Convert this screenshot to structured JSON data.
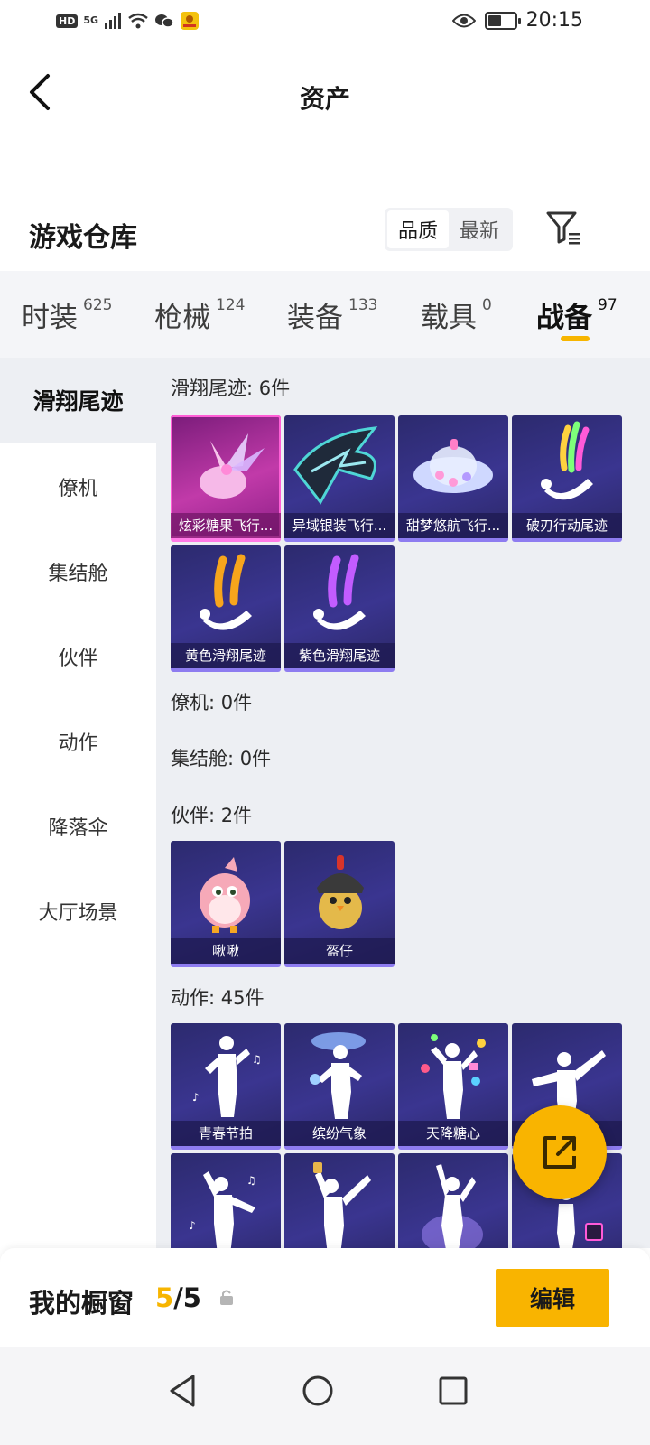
{
  "status_bar": {
    "hd_badge": "HD",
    "network": "5G",
    "time": "20:15",
    "battery_level": 0.5
  },
  "header": {
    "title": "资产"
  },
  "warehouse": {
    "title": "游戏仓库",
    "sort_options": [
      "品质",
      "最新"
    ],
    "sort_selected": "品质"
  },
  "tabs": [
    {
      "label": "时装",
      "count": "625"
    },
    {
      "label": "枪械",
      "count": "124"
    },
    {
      "label": "装备",
      "count": "133"
    },
    {
      "label": "载具",
      "count": "0"
    },
    {
      "label": "战备",
      "count": "97",
      "active": true
    }
  ],
  "sidebar": {
    "items": [
      {
        "label": "滑翔尾迹",
        "active": true
      },
      {
        "label": "僚机"
      },
      {
        "label": "集结舱"
      },
      {
        "label": "伙伴"
      },
      {
        "label": "动作"
      },
      {
        "label": "降落伞"
      },
      {
        "label": "大厅场景"
      }
    ]
  },
  "sections": {
    "glide": {
      "title": "滑翔尾迹: 6件",
      "items": [
        {
          "label": "炫彩糖果飞行...",
          "art": "candy-wing-icon"
        },
        {
          "label": "异域银装飞行...",
          "art": "silver-wing-icon"
        },
        {
          "label": "甜梦悠航飞行...",
          "art": "saucer-icon"
        },
        {
          "label": "破刃行动尾迹",
          "art": "rainbow-trail-icon"
        },
        {
          "label": "黄色滑翔尾迹",
          "art": "yellow-trail-icon"
        },
        {
          "label": "紫色滑翔尾迹",
          "art": "purple-trail-icon"
        }
      ]
    },
    "wingman": {
      "title": "僚机: 0件"
    },
    "capsule": {
      "title": "集结舱: 0件"
    },
    "partner": {
      "title": "伙伴: 2件",
      "items": [
        {
          "label": "啾啾",
          "art": "pink-bird-icon"
        },
        {
          "label": "盔仔",
          "art": "helmet-chick-icon"
        }
      ]
    },
    "emote": {
      "title": "动作: 45件",
      "items": [
        {
          "label": "青春节拍",
          "art": "dance-icon"
        },
        {
          "label": "缤纷气象",
          "art": "weather-icon"
        },
        {
          "label": "天降糖心",
          "art": "candy-rain-icon"
        },
        {
          "label": "",
          "art": "dab-icon"
        },
        {
          "label": "",
          "art": "dance-icon"
        },
        {
          "label": "",
          "art": "cheer-icon"
        },
        {
          "label": "",
          "art": "spotlight-icon"
        },
        {
          "label": "",
          "art": "pose-icon"
        }
      ]
    }
  },
  "bottom": {
    "showcase_label": "我的橱窗",
    "count_current": "5",
    "count_sep": "/",
    "count_total": "5",
    "edit_label": "编辑"
  },
  "colors": {
    "accent": "#f9b400",
    "card_bg": "#3a3590",
    "card_highlight": "#c13aa9"
  }
}
